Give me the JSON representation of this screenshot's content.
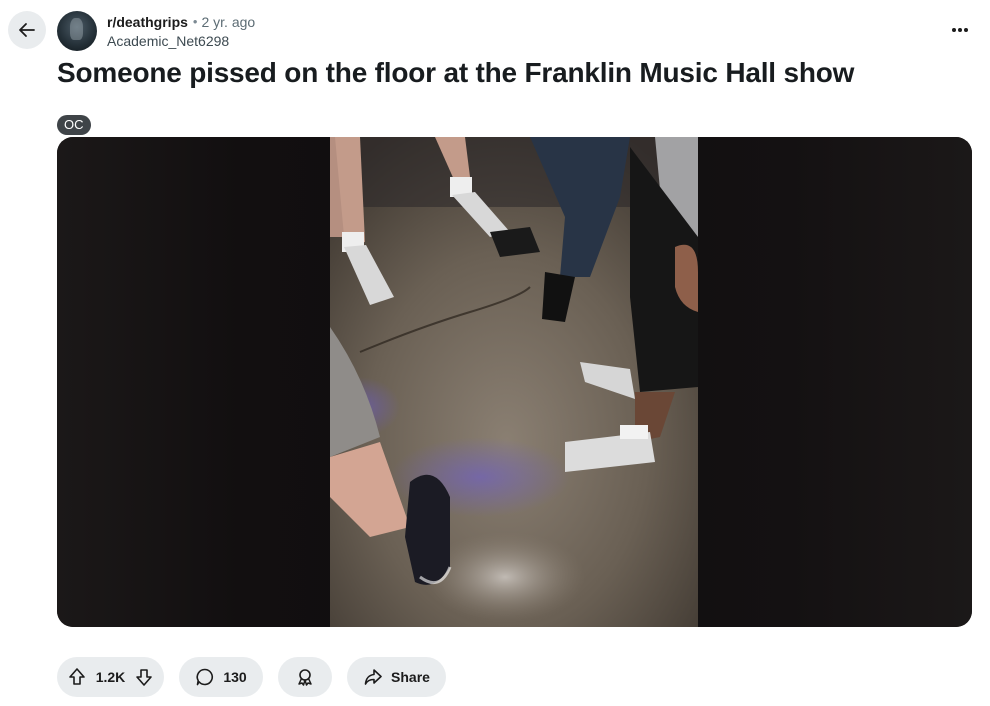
{
  "header": {
    "back_icon": "arrow-left-icon",
    "subreddit": "r/deathgrips",
    "separator": "•",
    "time": "2 yr. ago",
    "author": "Academic_Net6298",
    "more_icon": "more-horizontal-icon"
  },
  "post": {
    "title": "Someone pissed on the floor at the Franklin Music Hall show",
    "flair": "OC"
  },
  "actions": {
    "vote_count": "1.2K",
    "comment_count": "130",
    "share_label": "Share",
    "upvote_icon": "arrow-up-icon",
    "downvote_icon": "arrow-down-icon",
    "comment_icon": "speech-bubble-icon",
    "award_icon": "award-ribbon-icon",
    "share_icon": "share-arrow-icon"
  },
  "colors": {
    "pill_bg": "#e9ecee",
    "flair_bg": "#3f4448",
    "text": "#1c1c1c",
    "meta": "#5c6c74"
  }
}
